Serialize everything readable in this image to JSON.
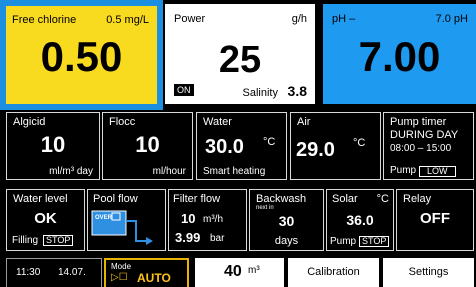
{
  "chlorine": {
    "label": "Free chlorine",
    "setpoint": "0.5 mg/L",
    "value": "0.50"
  },
  "power": {
    "label": "Power",
    "unit": "g/h",
    "value": "25",
    "status": "ON",
    "salinity_label": "Salinity",
    "salinity_value": "3.8"
  },
  "ph": {
    "label": "pH –",
    "setpoint": "7.0 pH",
    "value": "7.00"
  },
  "algicid": {
    "label": "Algicid",
    "value": "10",
    "unit": "ml/m³ day"
  },
  "flocc": {
    "label": "Flocc",
    "value": "10",
    "unit": "ml/hour"
  },
  "water": {
    "label": "Water",
    "value": "30.0",
    "unit": "°C",
    "mode": "Smart heating"
  },
  "air": {
    "label": "Air",
    "value": "29.0",
    "unit": "°C"
  },
  "pump_timer": {
    "label": "Pump timer",
    "line1": "DURING DAY",
    "line2": "08:00 – 15:00",
    "pump_label": "Pump",
    "pump_value": "LOW"
  },
  "water_level": {
    "label": "Water level",
    "value": "OK",
    "filling_label": "Filling",
    "filling_value": "STOP"
  },
  "pool_flow": {
    "label": "Pool flow",
    "overflow": "OVER"
  },
  "filter_flow": {
    "label": "Filter flow",
    "flow_value": "10",
    "flow_unit": "m³/h",
    "pressure_value": "3.99",
    "pressure_unit": "bar"
  },
  "backwash": {
    "label": "Backwash",
    "sub": "next in",
    "value": "30",
    "unit": "days"
  },
  "solar": {
    "label": "Solar",
    "unit": "°C",
    "value": "36.0",
    "pump_label": "Pump",
    "pump_value": "STOP"
  },
  "relay": {
    "label": "Relay",
    "value": "OFF"
  },
  "footer": {
    "time": "11:30",
    "date": "14.07.",
    "mode_label": "Mode",
    "mode_icons": "▷☐",
    "mode_value": "AUTO",
    "volume_value": "40",
    "volume_unit": "m³",
    "calibration": "Calibration",
    "settings": "Settings"
  },
  "colors": {
    "chlorine_bg": "#f8da1f",
    "chlorine_border": "#1c8fe0",
    "ph_bg": "#1e9af0",
    "mode_border": "#e8b400",
    "mode_text": "#ffc21a"
  }
}
